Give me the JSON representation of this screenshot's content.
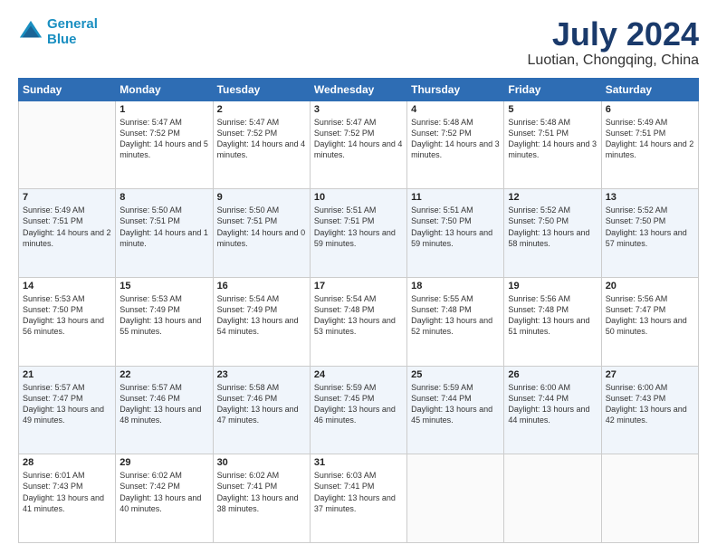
{
  "header": {
    "logo_line1": "General",
    "logo_line2": "Blue",
    "title": "July 2024",
    "subtitle": "Luotian, Chongqing, China"
  },
  "weekdays": [
    "Sunday",
    "Monday",
    "Tuesday",
    "Wednesday",
    "Thursday",
    "Friday",
    "Saturday"
  ],
  "weeks": [
    [
      {
        "day": "",
        "sunrise": "",
        "sunset": "",
        "daylight": ""
      },
      {
        "day": "1",
        "sunrise": "Sunrise: 5:47 AM",
        "sunset": "Sunset: 7:52 PM",
        "daylight": "Daylight: 14 hours and 5 minutes."
      },
      {
        "day": "2",
        "sunrise": "Sunrise: 5:47 AM",
        "sunset": "Sunset: 7:52 PM",
        "daylight": "Daylight: 14 hours and 4 minutes."
      },
      {
        "day": "3",
        "sunrise": "Sunrise: 5:47 AM",
        "sunset": "Sunset: 7:52 PM",
        "daylight": "Daylight: 14 hours and 4 minutes."
      },
      {
        "day": "4",
        "sunrise": "Sunrise: 5:48 AM",
        "sunset": "Sunset: 7:52 PM",
        "daylight": "Daylight: 14 hours and 3 minutes."
      },
      {
        "day": "5",
        "sunrise": "Sunrise: 5:48 AM",
        "sunset": "Sunset: 7:51 PM",
        "daylight": "Daylight: 14 hours and 3 minutes."
      },
      {
        "day": "6",
        "sunrise": "Sunrise: 5:49 AM",
        "sunset": "Sunset: 7:51 PM",
        "daylight": "Daylight: 14 hours and 2 minutes."
      }
    ],
    [
      {
        "day": "7",
        "sunrise": "Sunrise: 5:49 AM",
        "sunset": "Sunset: 7:51 PM",
        "daylight": "Daylight: 14 hours and 2 minutes."
      },
      {
        "day": "8",
        "sunrise": "Sunrise: 5:50 AM",
        "sunset": "Sunset: 7:51 PM",
        "daylight": "Daylight: 14 hours and 1 minute."
      },
      {
        "day": "9",
        "sunrise": "Sunrise: 5:50 AM",
        "sunset": "Sunset: 7:51 PM",
        "daylight": "Daylight: 14 hours and 0 minutes."
      },
      {
        "day": "10",
        "sunrise": "Sunrise: 5:51 AM",
        "sunset": "Sunset: 7:51 PM",
        "daylight": "Daylight: 13 hours and 59 minutes."
      },
      {
        "day": "11",
        "sunrise": "Sunrise: 5:51 AM",
        "sunset": "Sunset: 7:50 PM",
        "daylight": "Daylight: 13 hours and 59 minutes."
      },
      {
        "day": "12",
        "sunrise": "Sunrise: 5:52 AM",
        "sunset": "Sunset: 7:50 PM",
        "daylight": "Daylight: 13 hours and 58 minutes."
      },
      {
        "day": "13",
        "sunrise": "Sunrise: 5:52 AM",
        "sunset": "Sunset: 7:50 PM",
        "daylight": "Daylight: 13 hours and 57 minutes."
      }
    ],
    [
      {
        "day": "14",
        "sunrise": "Sunrise: 5:53 AM",
        "sunset": "Sunset: 7:50 PM",
        "daylight": "Daylight: 13 hours and 56 minutes."
      },
      {
        "day": "15",
        "sunrise": "Sunrise: 5:53 AM",
        "sunset": "Sunset: 7:49 PM",
        "daylight": "Daylight: 13 hours and 55 minutes."
      },
      {
        "day": "16",
        "sunrise": "Sunrise: 5:54 AM",
        "sunset": "Sunset: 7:49 PM",
        "daylight": "Daylight: 13 hours and 54 minutes."
      },
      {
        "day": "17",
        "sunrise": "Sunrise: 5:54 AM",
        "sunset": "Sunset: 7:48 PM",
        "daylight": "Daylight: 13 hours and 53 minutes."
      },
      {
        "day": "18",
        "sunrise": "Sunrise: 5:55 AM",
        "sunset": "Sunset: 7:48 PM",
        "daylight": "Daylight: 13 hours and 52 minutes."
      },
      {
        "day": "19",
        "sunrise": "Sunrise: 5:56 AM",
        "sunset": "Sunset: 7:48 PM",
        "daylight": "Daylight: 13 hours and 51 minutes."
      },
      {
        "day": "20",
        "sunrise": "Sunrise: 5:56 AM",
        "sunset": "Sunset: 7:47 PM",
        "daylight": "Daylight: 13 hours and 50 minutes."
      }
    ],
    [
      {
        "day": "21",
        "sunrise": "Sunrise: 5:57 AM",
        "sunset": "Sunset: 7:47 PM",
        "daylight": "Daylight: 13 hours and 49 minutes."
      },
      {
        "day": "22",
        "sunrise": "Sunrise: 5:57 AM",
        "sunset": "Sunset: 7:46 PM",
        "daylight": "Daylight: 13 hours and 48 minutes."
      },
      {
        "day": "23",
        "sunrise": "Sunrise: 5:58 AM",
        "sunset": "Sunset: 7:46 PM",
        "daylight": "Daylight: 13 hours and 47 minutes."
      },
      {
        "day": "24",
        "sunrise": "Sunrise: 5:59 AM",
        "sunset": "Sunset: 7:45 PM",
        "daylight": "Daylight: 13 hours and 46 minutes."
      },
      {
        "day": "25",
        "sunrise": "Sunrise: 5:59 AM",
        "sunset": "Sunset: 7:44 PM",
        "daylight": "Daylight: 13 hours and 45 minutes."
      },
      {
        "day": "26",
        "sunrise": "Sunrise: 6:00 AM",
        "sunset": "Sunset: 7:44 PM",
        "daylight": "Daylight: 13 hours and 44 minutes."
      },
      {
        "day": "27",
        "sunrise": "Sunrise: 6:00 AM",
        "sunset": "Sunset: 7:43 PM",
        "daylight": "Daylight: 13 hours and 42 minutes."
      }
    ],
    [
      {
        "day": "28",
        "sunrise": "Sunrise: 6:01 AM",
        "sunset": "Sunset: 7:43 PM",
        "daylight": "Daylight: 13 hours and 41 minutes."
      },
      {
        "day": "29",
        "sunrise": "Sunrise: 6:02 AM",
        "sunset": "Sunset: 7:42 PM",
        "daylight": "Daylight: 13 hours and 40 minutes."
      },
      {
        "day": "30",
        "sunrise": "Sunrise: 6:02 AM",
        "sunset": "Sunset: 7:41 PM",
        "daylight": "Daylight: 13 hours and 38 minutes."
      },
      {
        "day": "31",
        "sunrise": "Sunrise: 6:03 AM",
        "sunset": "Sunset: 7:41 PM",
        "daylight": "Daylight: 13 hours and 37 minutes."
      },
      {
        "day": "",
        "sunrise": "",
        "sunset": "",
        "daylight": ""
      },
      {
        "day": "",
        "sunrise": "",
        "sunset": "",
        "daylight": ""
      },
      {
        "day": "",
        "sunrise": "",
        "sunset": "",
        "daylight": ""
      }
    ]
  ]
}
